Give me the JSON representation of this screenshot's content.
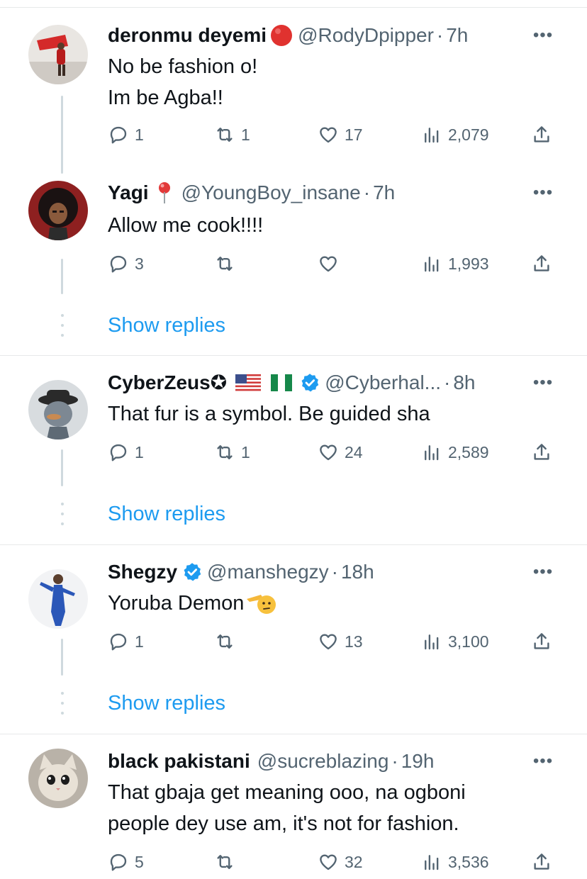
{
  "tweets": [
    {
      "name": "deronmu deyemi",
      "handle": "@RodyDpipper",
      "time": "7h",
      "text": [
        "No be fashion o!",
        "Im be Agba!!"
      ],
      "replies": "1",
      "retweets": "1",
      "likes": "17",
      "views": "2,079",
      "badge": "red-circle-emoji"
    },
    {
      "name": "Yagi",
      "handle": "@YoungBoy_insane",
      "time": "7h",
      "text": [
        "Allow me cook!!!!"
      ],
      "replies": "3",
      "retweets": "",
      "likes": "",
      "views": "1,993",
      "badge": "round-pushpin-emoji"
    },
    {
      "name": "CyberZeus✪",
      "handle": "@Cyberhal...",
      "time": "8h",
      "text": [
        "That fur is a symbol. Be guided sha"
      ],
      "replies": "1",
      "retweets": "1",
      "likes": "24",
      "views": "2,589",
      "badge": "us-flag-nigeria-flag-verified"
    },
    {
      "name": "Shegzy",
      "handle": "@manshegzy",
      "time": "18h",
      "text": [
        "Yoruba Demon"
      ],
      "replies": "1",
      "retweets": "",
      "likes": "13",
      "views": "3,100",
      "badge": "verified-badge"
    },
    {
      "name": "black pakistani",
      "handle": "@sucreblazing",
      "time": "19h",
      "text": [
        "That gbaja get meaning ooo, na ogboni",
        "people dey use am, it's not for fashion."
      ],
      "replies": "5",
      "retweets": "",
      "likes": "32",
      "views": "3,536",
      "badge": ""
    }
  ],
  "show_replies_label": "Show replies",
  "separator_dot": "·",
  "more_glyph": "•••",
  "colors": {
    "text": "#0f1419",
    "secondary": "#536471",
    "link": "#1d9bf0",
    "verified": "#1d9bf0",
    "divider": "#e7e9ea",
    "thread_line": "#cfd9de"
  }
}
